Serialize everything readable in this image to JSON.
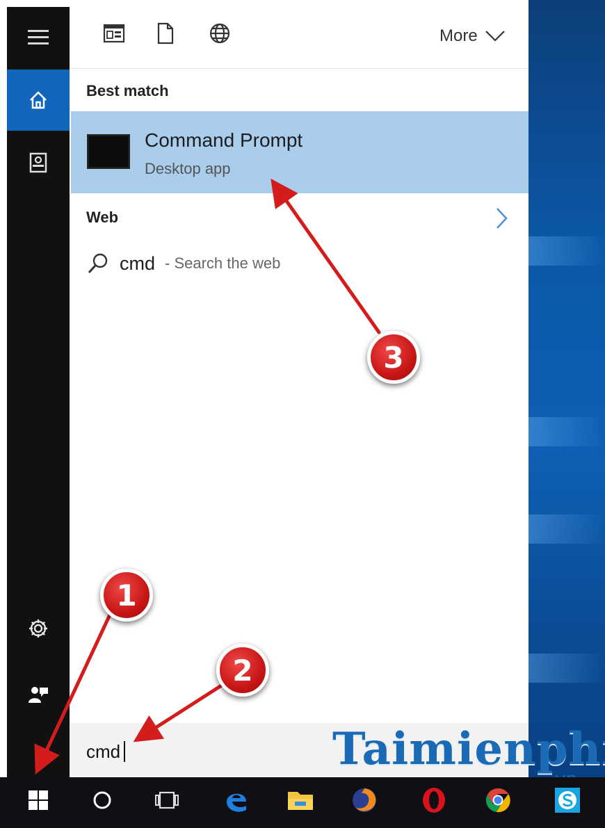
{
  "top_bar": {
    "filter_icons": [
      "apps-filter-icon",
      "documents-filter-icon",
      "web-filter-icon"
    ],
    "more_label": "More"
  },
  "sidebar": {
    "items": [
      "menu-icon",
      "home-icon",
      "notebook-icon",
      "settings-icon",
      "feedback-icon"
    ]
  },
  "results": {
    "best_match_header": "Best match",
    "best_match": {
      "title": "Command Prompt",
      "subtitle": "Desktop app",
      "icon": "command-prompt-icon"
    },
    "web_header": "Web",
    "web_result": {
      "query": "cmd",
      "suffix": "- Search the web"
    }
  },
  "search": {
    "value": "cmd"
  },
  "watermark": {
    "main": "Taimienphi",
    "sub": ".vn"
  },
  "taskbar": {
    "items": [
      "start-icon",
      "cortana-icon",
      "task-view-icon",
      "edge-icon",
      "file-explorer-icon",
      "firefox-icon",
      "opera-icon",
      "chrome-icon",
      "skype-icon"
    ]
  },
  "annotations": {
    "badge1": "1",
    "badge2": "2",
    "badge3": "3"
  },
  "colors": {
    "accent": "#1166bb",
    "selection": "#a9cdeb",
    "annotation": "#cc1a1a",
    "watermark": "#1a6ab5"
  }
}
